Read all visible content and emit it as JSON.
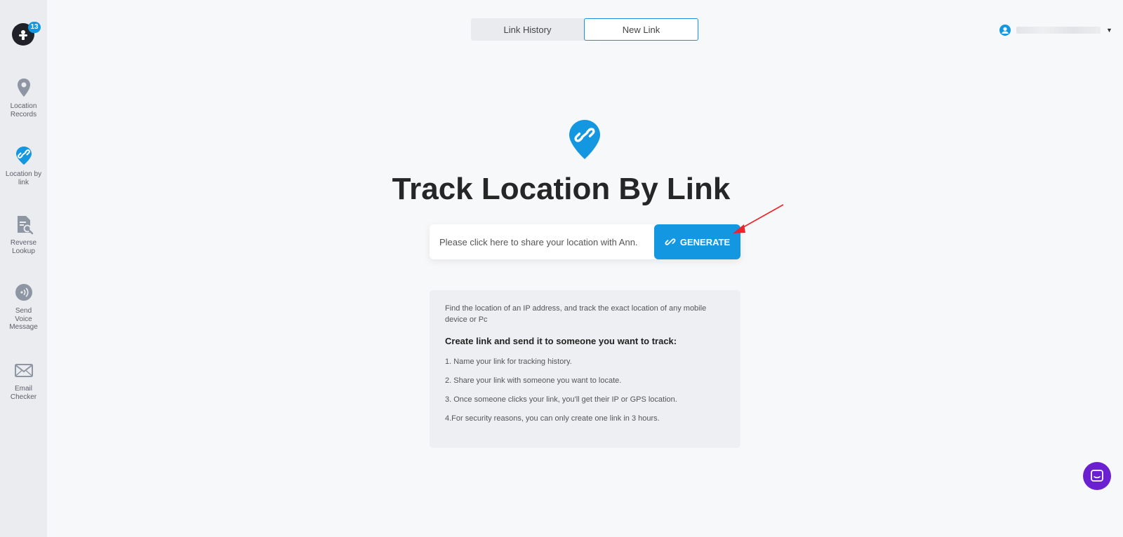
{
  "sidebar": {
    "logo_badge": "13",
    "items": [
      {
        "label": "Location Records",
        "icon": "map-pin-icon"
      },
      {
        "label": "Location by link",
        "icon": "link-pin-icon"
      },
      {
        "label": "Reverse Lookup",
        "icon": "document-search-icon"
      },
      {
        "label": "Send Voice Message",
        "icon": "voice-wave-icon"
      },
      {
        "label": "Email Checker",
        "icon": "envelope-icon"
      }
    ]
  },
  "tabs": [
    {
      "label": "Link History"
    },
    {
      "label": "New Link",
      "active": true
    }
  ],
  "main": {
    "title": "Track Location By Link",
    "share_input_value": "Please click here to share your location with Ann.",
    "generate_label": "GENERATE"
  },
  "info": {
    "description": "Find the location of an IP address, and track the exact location of any mobile device or Pc",
    "heading": "Create link and send it to someone you want to track:",
    "steps": [
      "1. Name your link for tracking history.",
      "2. Share your link with someone you want to locate.",
      "3. Once someone clicks your link, you'll get their IP or GPS location.",
      "4.For security reasons, you can only create one link in 3 hours."
    ]
  },
  "colors": {
    "accent": "#1297e0",
    "sidebar_bg": "#ebecf0",
    "chat": "#6a1fd0",
    "arrow": "#e8262b"
  }
}
